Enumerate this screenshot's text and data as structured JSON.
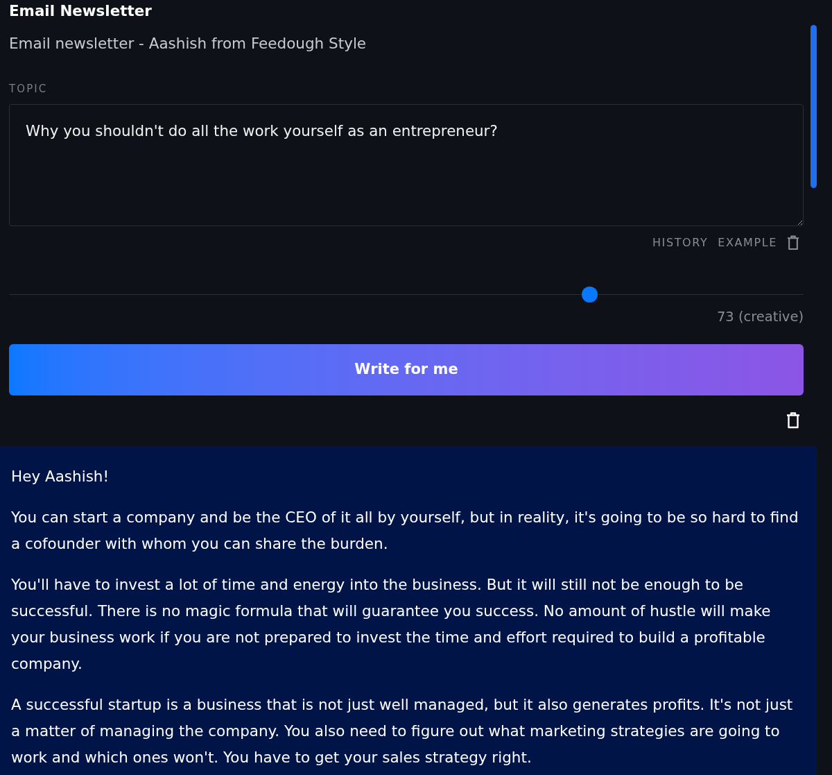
{
  "header": {
    "title": "Email Newsletter",
    "subtitle": "Email newsletter - Aashish from Feedough Style"
  },
  "topic": {
    "label": "TOPIC",
    "value": "Why you shouldn't do all the work yourself as an entrepreneur?"
  },
  "topic_actions": [
    "HISTORY",
    "EXAMPLE"
  ],
  "creativity": {
    "level": 0.73,
    "reading": "73 (creative)"
  },
  "submit_button": {
    "label": "Write for me"
  },
  "output": {
    "paragraphs": [
      "Hey Aashish!",
      "You can start a company and be the CEO of it all by yourself, but in reality, it's going to be so hard to find a cofounder with whom you can share the burden.",
      "You'll have to invest a lot of time and energy into the business. But it will still not be enough to be successful. There is no magic formula that will guarantee you success. No amount of hustle will make your business work if you are not prepared to invest the time and effort required to build a profitable company.",
      "A successful startup is a business that is not just well managed, but it also generates profits. It's not just a matter of managing the company. You also need to figure out what marketing strategies are going to work and which ones won't. You have to get your sales strategy right."
    ]
  }
}
